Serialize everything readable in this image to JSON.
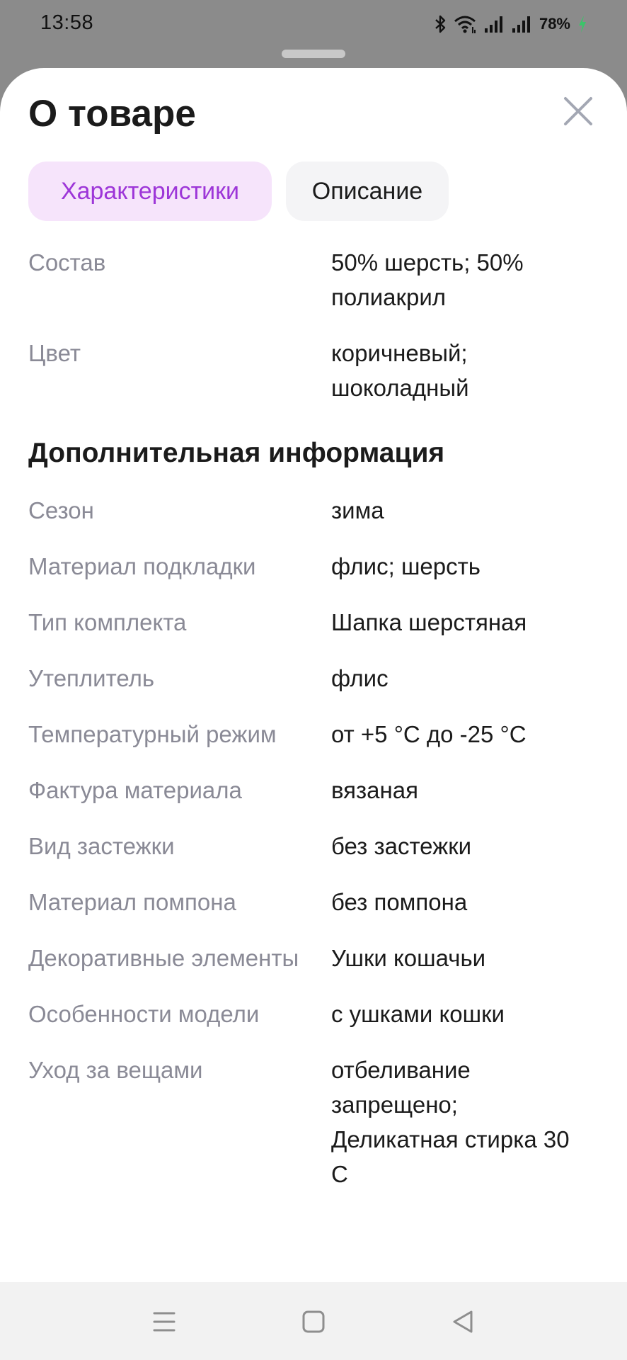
{
  "status_bar": {
    "time": "13:58",
    "battery": "78%",
    "icons": [
      "bluetooth-icon",
      "wifi-icon",
      "signal-icon",
      "signal-icon",
      "battery-charging-icon"
    ]
  },
  "sheet": {
    "title": "О товаре",
    "close_icon": "close-icon"
  },
  "tabs": [
    {
      "label": "Характеристики",
      "active": true
    },
    {
      "label": "Описание",
      "active": false
    }
  ],
  "main_props": [
    {
      "name": "Состав",
      "value": "50% шерсть; 50% полиакрил"
    },
    {
      "name": "Цвет",
      "value": "коричневый; шоколадный"
    }
  ],
  "additional": {
    "title": "Дополнительная информация",
    "props": [
      {
        "name": "Сезон",
        "value": "зима"
      },
      {
        "name": "Материал подкладки",
        "value": "флис; шерсть"
      },
      {
        "name": "Тип комплекта",
        "value": "Шапка шерстяная"
      },
      {
        "name": "Утеплитель",
        "value": "флис"
      },
      {
        "name": "Температурный режим",
        "value": "от +5 °C до -25 °C"
      },
      {
        "name": "Фактура материала",
        "value": "вязаная"
      },
      {
        "name": "Вид застежки",
        "value": "без застежки"
      },
      {
        "name": "Материал помпона",
        "value": "без помпона"
      },
      {
        "name": "Декоративные элементы",
        "value": "Ушки кошачьи"
      },
      {
        "name": "Особенности модели",
        "value": "с ушками кошки"
      },
      {
        "name": "Уход за вещами",
        "value": "отбеливание запрещено; Деликатная стирка 30 C"
      }
    ]
  },
  "nav_bar": {
    "icons": [
      "menu-icon",
      "home-square-icon",
      "back-triangle-icon"
    ]
  },
  "colors": {
    "accent": "#9d36d8",
    "accent_bg": "#f6e4fb",
    "muted_text": "#8a8a96",
    "overlay": "#8b8b8b"
  }
}
